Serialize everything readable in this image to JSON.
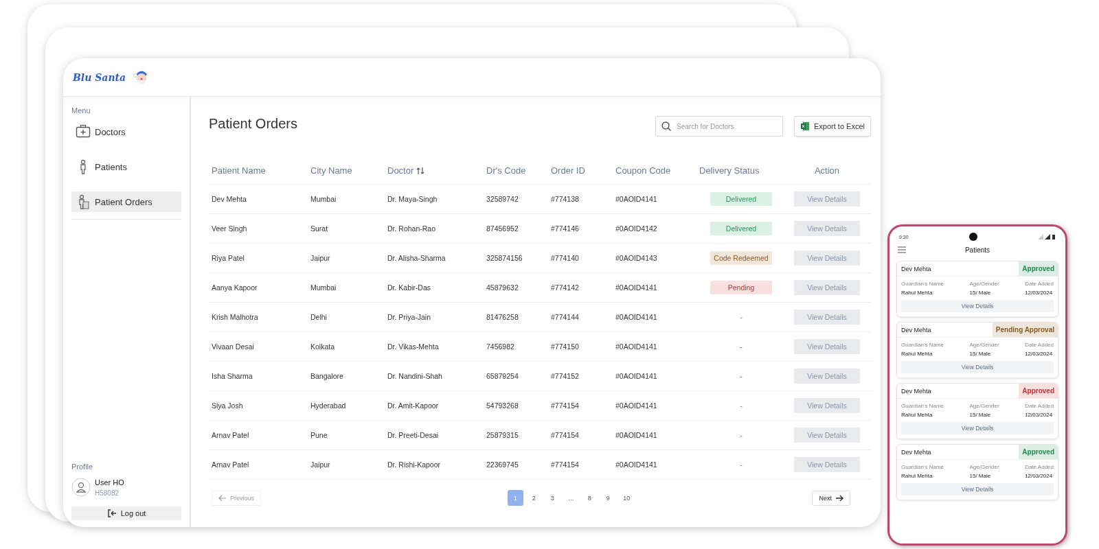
{
  "logo": {
    "text": "Blu Santa"
  },
  "sidebar": {
    "menu_label": "Menu",
    "items": [
      {
        "label": "Doctors",
        "selected": false
      },
      {
        "label": "Patients",
        "selected": false
      },
      {
        "label": "Patient Orders",
        "selected": true
      }
    ],
    "profile_label": "Profile",
    "user_name": "User HO",
    "user_id": "H58082",
    "logout": "Log out"
  },
  "page": {
    "title": "Patient Orders",
    "search": {
      "placeholder": "Search for Doctors"
    },
    "export_button": "Export to Excel"
  },
  "table": {
    "columns": [
      {
        "label": "Patient Name"
      },
      {
        "label": "City Name"
      },
      {
        "label": "Doctor",
        "sortable": true
      },
      {
        "label": "Dr's Code"
      },
      {
        "label": "Order ID"
      },
      {
        "label": "Coupon Code"
      },
      {
        "label": "Delivery Status"
      },
      {
        "label": "Action"
      }
    ],
    "rows": [
      {
        "cells": [
          "Dev Mehta",
          "Mumbai",
          "Dr. Maya-Singh",
          "32589742",
          "#774138",
          "#0AOID4141"
        ],
        "status": "Delivered",
        "color": "#1f9d55",
        "action": "View Details"
      },
      {
        "cells": [
          "Veer Singh",
          "Surat",
          "Dr. Rohan-Rao",
          "87456952",
          "#774146",
          "#0AOID4142"
        ],
        "status": "Delivered",
        "color": "#1f9d55",
        "action": "View Details"
      },
      {
        "cells": [
          "Riya Patel",
          "Jaipur",
          "Dr. Alisha-Sharma",
          "325874156",
          "#774140",
          "#0AOID4143"
        ],
        "status": "Code Redeemed",
        "color": "#9a5b14",
        "action": "View Details"
      },
      {
        "cells": [
          "Aanya Kapoor",
          "Mumbai",
          "Dr. Kabir-Das",
          "45879632",
          "#774142",
          "#0AOID4141"
        ],
        "status": "Pending",
        "color": "#c53030",
        "action": "View Details"
      },
      {
        "cells": [
          "Krish Malhotra",
          "Delhi",
          "Dr. Priya-Jain",
          "81476258",
          "#774144",
          "#0AOID4141"
        ],
        "status": "-",
        "action": "View Details"
      },
      {
        "cells": [
          "Vivaan Desai",
          "Kolkata",
          "Dr. Vikas-Mehta",
          "7456982",
          "#774150",
          "#0AOID4141"
        ],
        "status": "-",
        "action": "View Details"
      },
      {
        "cells": [
          "Isha Sharma",
          "Bangalore",
          "Dr. Nandini-Shah",
          "65879254",
          "#774152",
          "#0AOID4141"
        ],
        "status": "-",
        "action": "View Details"
      },
      {
        "cells": [
          "Siya Josh",
          "Hyderabad",
          "Dr. Amit-Kapoor",
          "54793268",
          "#774154",
          "#0AOID4141"
        ],
        "status": "-",
        "action": "View Details"
      },
      {
        "cells": [
          "Arnav Patel",
          "Pune",
          "Dr. Preeti-Desai",
          "25879315",
          "#774154",
          "#0AOID4141"
        ],
        "status": "-",
        "action": "View Details"
      },
      {
        "cells": [
          "Arnav Patel",
          "Jaipur",
          "Dr. Rishi-Kapoor",
          "22369745",
          "#774154",
          "#0AOID4141"
        ],
        "status": "-",
        "action": "View Details"
      }
    ]
  },
  "pagination": {
    "previous": {
      "label": "Previous",
      "disabled": true
    },
    "pages": [
      {
        "label": "1",
        "selected": true
      },
      {
        "label": "2",
        "selected": false
      },
      {
        "label": "3",
        "selected": false
      },
      {
        "label": "...",
        "selected": false
      },
      {
        "label": "8",
        "selected": false
      },
      {
        "label": "9",
        "selected": false
      },
      {
        "label": "10",
        "selected": false
      }
    ],
    "next": {
      "label": "Next",
      "disabled": false
    }
  },
  "phone": {
    "time": "9:30",
    "title": "Patients",
    "cards": [
      {
        "name": "Dev Mehta",
        "status": "Approved",
        "color": "#1f8a4c",
        "fields": [
          {
            "label": "Guardian's Name",
            "value": "Rahul Mehta"
          },
          {
            "label": "Age/Gender",
            "value": "15/ Male"
          },
          {
            "label": "Date Added",
            "value": "12/03/2024"
          }
        ],
        "action": "View Details"
      },
      {
        "name": "Dev Mehta",
        "status": "Pending Approval",
        "color": "#8a5a1a",
        "fields": [
          {
            "label": "Guardian's Name",
            "value": "Rahul Mehta"
          },
          {
            "label": "Age/Gender",
            "value": "15/ Male"
          },
          {
            "label": "Date Added",
            "value": "12/03/2024"
          }
        ],
        "action": "View Details"
      },
      {
        "name": "Dev Mehta",
        "status": "Approved",
        "color": "#c53030",
        "fields": [
          {
            "label": "Guardian's Name",
            "value": "Rahul Mehta"
          },
          {
            "label": "Age/Gender",
            "value": "15/ Male"
          },
          {
            "label": "Date Added",
            "value": "12/03/2024"
          }
        ],
        "action": "View Details"
      },
      {
        "name": "Dev Mehta",
        "status": "Approved",
        "color": "#1f8a4c",
        "fields": [
          {
            "label": "Guardian's Name",
            "value": "Rahul Mehta"
          },
          {
            "label": "Age/Gender",
            "value": "15/ Male"
          },
          {
            "label": "Date Added",
            "value": "12/03/2024"
          }
        ],
        "action": "View Details"
      }
    ]
  }
}
